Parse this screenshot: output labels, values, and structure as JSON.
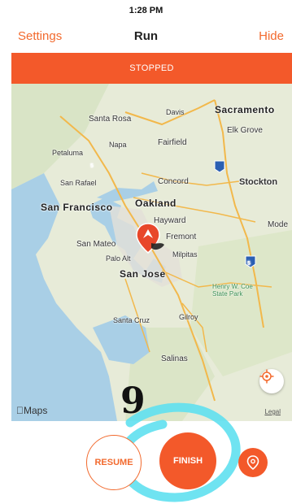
{
  "status_bar": {
    "time": "1:28 PM"
  },
  "nav": {
    "left_label": "Settings",
    "title": "Run",
    "right_label": "Hide"
  },
  "banner": {
    "text": "STOPPED",
    "color": "#f3592a"
  },
  "map": {
    "labels": {
      "sacramento": "Sacramento",
      "davis": "Davis",
      "santa_rosa": "Santa Rosa",
      "elk_grove": "Elk Grove",
      "napa": "Napa",
      "fairfield": "Fairfield",
      "petaluma": "Petaluma",
      "san_rafael": "San Rafael",
      "concord": "Concord",
      "stockton": "Stockton",
      "san_francisco": "San Francisco",
      "oakland": "Oakland",
      "hayward": "Hayward",
      "modesto": "Mode",
      "fremont": "Fremont",
      "san_mateo": "San Mateo",
      "palo_alto": "Palo Alt",
      "milpitas": "Milpitas",
      "san_jose": "San Jose",
      "henry_coe": "Henry W. Coe\nState Park",
      "santa_cruz": "Santa Cruz",
      "gilroy": "Gilroy",
      "salinas": "Salinas"
    },
    "shields": [
      "5",
      "5"
    ],
    "attribution": "Maps",
    "legal": "Legal"
  },
  "annotation": {
    "digit": "9"
  },
  "controls": {
    "resume_label": "RESUME",
    "finish_label": "FINISH"
  },
  "icons": [
    "locate-icon",
    "map-pin-icon",
    "route-marker-icon",
    "apple-logo-icon"
  ],
  "colors": {
    "accent": "#f26a2e",
    "annotation_cyan": "#5fe0f0"
  }
}
